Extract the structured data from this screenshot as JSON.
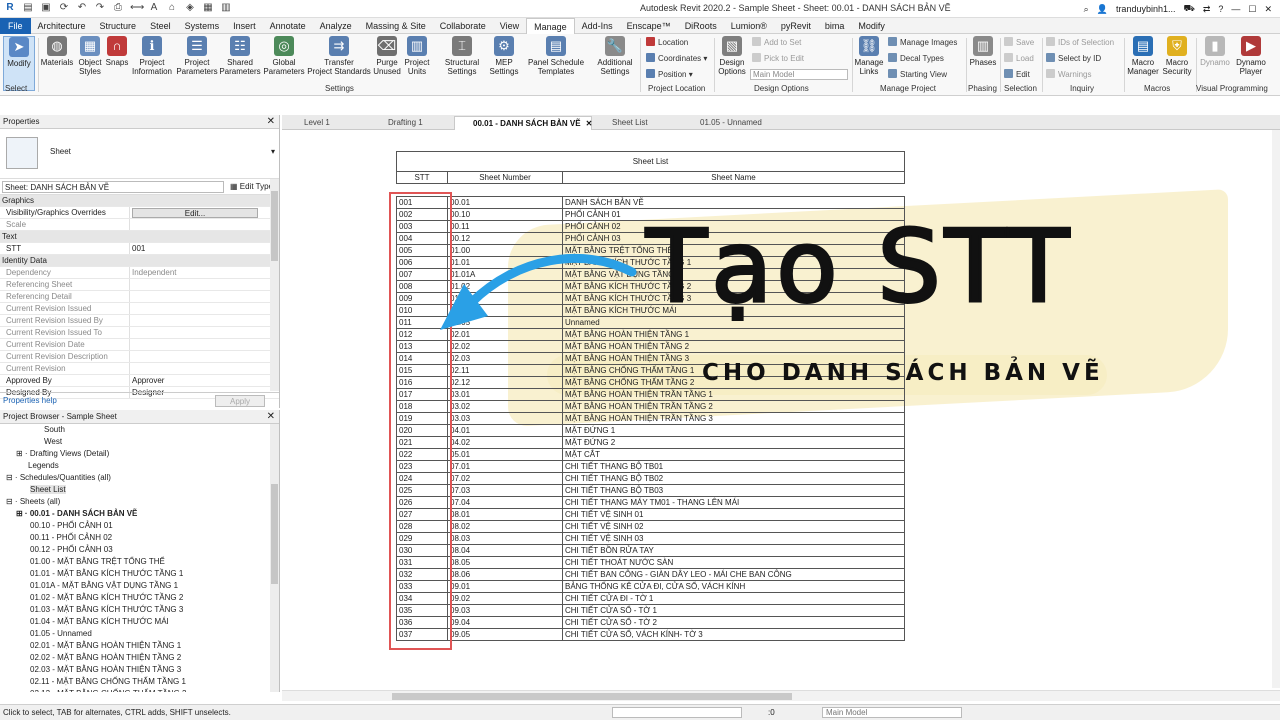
{
  "window": {
    "title": "Autodesk Revit 2020.2 - Sample Sheet - Sheet: 00.01 - DANH SÁCH BẢN VẼ",
    "user": "tranduybinh1..."
  },
  "tabs": [
    "File",
    "Architecture",
    "Structure",
    "Steel",
    "Systems",
    "Insert",
    "Annotate",
    "Analyze",
    "Massing & Site",
    "Collaborate",
    "View",
    "Manage",
    "Add-Ins",
    "Enscape™",
    "DiRoots",
    "Lumion®",
    "pyRevit",
    "bima",
    "Modify"
  ],
  "active_tab": "Manage",
  "ribbon": {
    "modify": "Modify",
    "select_label": "Select",
    "settings_buttons": [
      "Materials",
      "Object\nStyles",
      "Snaps",
      "Project\nInformation",
      "Project\nParameters",
      "Shared\nParameters",
      "Global\nParameters",
      "Transfer\nProject Standards",
      "Purge\nUnused",
      "Project\nUnits",
      "Structural\nSettings",
      "MEP\nSettings",
      "Panel Schedule\nTemplates",
      "Additional\nSettings"
    ],
    "settings_label": "Settings",
    "location_items": [
      "Location",
      "Coordinates",
      "Position"
    ],
    "location_label": "Project Location",
    "design_options": "Design\nOptions",
    "add_to_set": "Add to Set",
    "pick_to_edit": "Pick to Edit",
    "main_model": "Main Model",
    "design_options_label": "Design Options",
    "manage_links": "Manage\nLinks",
    "manage_images": "Manage Images",
    "decal_types": "Decal Types",
    "starting_view": "Starting View",
    "manage_project_label": "Manage Project",
    "phases": "Phases",
    "phasing_label": "Phasing",
    "save": "Save",
    "load": "Load",
    "edit": "Edit",
    "selection_label": "Selection",
    "ids_of_selection": "IDs of Selection",
    "select_by_id": "Select by ID",
    "warnings": "Warnings",
    "inquiry_label": "Inquiry",
    "macro_manager": "Macro\nManager",
    "macro_security": "Macro\nSecurity",
    "macros_label": "Macros",
    "dynamo": "Dynamo",
    "dynamo_player": "Dynamo\nPlayer",
    "visual_programming_label": "Visual Programming"
  },
  "properties": {
    "title": "Properties",
    "type_name": "Sheet",
    "instance": "Sheet: DANH SÁCH BẢN VẼ",
    "edit_type": "Edit Type",
    "rows": [
      {
        "k": "Graphics",
        "v": "",
        "group": true
      },
      {
        "k": "Visibility/Graphics Overrides",
        "v": "Edit...",
        "button": true
      },
      {
        "k": "Scale",
        "v": "",
        "gray": true
      },
      {
        "k": "Text",
        "v": "",
        "group": true
      },
      {
        "k": "STT",
        "v": "001"
      },
      {
        "k": "Identity Data",
        "v": "",
        "group": true
      },
      {
        "k": "Dependency",
        "v": "Independent",
        "gray": true
      },
      {
        "k": "Referencing Sheet",
        "v": "",
        "gray": true
      },
      {
        "k": "Referencing Detail",
        "v": "",
        "gray": true
      },
      {
        "k": "Current Revision Issued",
        "v": "",
        "gray": true
      },
      {
        "k": "Current Revision Issued By",
        "v": "",
        "gray": true
      },
      {
        "k": "Current Revision Issued To",
        "v": "",
        "gray": true
      },
      {
        "k": "Current Revision Date",
        "v": "",
        "gray": true
      },
      {
        "k": "Current Revision Description",
        "v": "",
        "gray": true
      },
      {
        "k": "Current Revision",
        "v": "",
        "gray": true
      },
      {
        "k": "Approved By",
        "v": "Approver"
      },
      {
        "k": "Designed By",
        "v": "Designer"
      }
    ],
    "help": "Properties help",
    "apply": "Apply"
  },
  "browser": {
    "title": "Project Browser - Sample Sheet",
    "items": [
      {
        "t": "South",
        "i": 44
      },
      {
        "t": "West",
        "i": 44
      },
      {
        "t": "⊞ · Drafting Views (Detail)",
        "i": 16
      },
      {
        "t": "Legends",
        "i": 28
      },
      {
        "t": "⊟ · Schedules/Quantities (all)",
        "i": 6
      },
      {
        "t": "Sheet List",
        "i": 30,
        "hl": true
      },
      {
        "t": "⊟ · Sheets (all)",
        "i": 6
      },
      {
        "t": "⊞ · 00.01 - DANH SÁCH BẢN VẼ",
        "i": 16,
        "bold": true
      },
      {
        "t": "00.10 - PHỐI CẢNH 01",
        "i": 30
      },
      {
        "t": "00.11 - PHỐI CẢNH 02",
        "i": 30
      },
      {
        "t": "00.12 - PHỐI CẢNH 03",
        "i": 30
      },
      {
        "t": "01.00 - MẶT BẰNG TRỆT TỔNG THỂ",
        "i": 30
      },
      {
        "t": "01.01 - MẶT BẰNG KÍCH THƯỚC TẦNG 1",
        "i": 30
      },
      {
        "t": "01.01A - MẶT BẰNG VẬT DỤNG TẦNG 1",
        "i": 30
      },
      {
        "t": "01.02 - MẶT BẰNG KÍCH THƯỚC TẦNG 2",
        "i": 30
      },
      {
        "t": "01.03 - MẶT BẰNG KÍCH THƯỚC TẦNG 3",
        "i": 30
      },
      {
        "t": "01.04 - MẶT BẰNG KÍCH THƯỚC MÁI",
        "i": 30
      },
      {
        "t": "01.05 - Unnamed",
        "i": 30
      },
      {
        "t": "02.01 - MẶT BẰNG HOÀN THIỆN TẦNG 1",
        "i": 30
      },
      {
        "t": "02.02 - MẶT BẰNG HOÀN THIỆN TẦNG 2",
        "i": 30
      },
      {
        "t": "02.03 - MẶT BẰNG HOÀN THIỆN TẦNG 3",
        "i": 30
      },
      {
        "t": "02.11 - MẶT BẰNG CHỐNG THẤM TẦNG 1",
        "i": 30
      },
      {
        "t": "02.12 - MẶT BẰNG CHỐNG THẤM TẦNG 2",
        "i": 30
      }
    ]
  },
  "view_tabs": [
    {
      "label": "Level 1",
      "active": false
    },
    {
      "label": "Drafting 1",
      "active": false
    },
    {
      "label": "00.01 - DANH SÁCH BẢN VẼ",
      "active": true
    },
    {
      "label": "Sheet List",
      "active": false
    },
    {
      "label": "01.05 - Unnamed",
      "active": false
    }
  ],
  "schedule": {
    "title": "Sheet List",
    "headers": [
      "STT",
      "Sheet Number",
      "Sheet Name"
    ],
    "rows": [
      [
        "001",
        "00.01",
        "DANH SÁCH BẢN VẼ"
      ],
      [
        "002",
        "00.10",
        "PHỐI CẢNH 01"
      ],
      [
        "003",
        "00.11",
        "PHỐI CẢNH 02"
      ],
      [
        "004",
        "00.12",
        "PHỐI CẢNH 03"
      ],
      [
        "005",
        "01.00",
        "MẶT BẰNG TRỆT TỔNG THỂ"
      ],
      [
        "006",
        "01.01",
        "MẶT BẰNG KÍCH THƯỚC TẦNG 1"
      ],
      [
        "007",
        "01.01A",
        "MẶT BẰNG VẬT DỤNG TẦNG 1"
      ],
      [
        "008",
        "01.02",
        "MẶT BẰNG KÍCH THƯỚC TẦNG 2"
      ],
      [
        "009",
        "01.03",
        "MẶT BẰNG KÍCH THƯỚC TẦNG 3"
      ],
      [
        "010",
        "01.04",
        "MẶT BẰNG KÍCH THƯỚC MÁI"
      ],
      [
        "011",
        "01.05",
        "Unnamed"
      ],
      [
        "012",
        "02.01",
        "MẶT BẰNG HOÀN THIỆN TẦNG 1"
      ],
      [
        "013",
        "02.02",
        "MẶT BẰNG HOÀN THIỆN TẦNG 2"
      ],
      [
        "014",
        "02.03",
        "MẶT BẰNG HOÀN THIỆN TẦNG 3"
      ],
      [
        "015",
        "02.11",
        "MẶT BẰNG CHỐNG THẤM TẦNG 1"
      ],
      [
        "016",
        "02.12",
        "MẶT BẰNG CHỐNG THẤM TẦNG 2"
      ],
      [
        "017",
        "03.01",
        "MẶT BẰNG HOÀN THIỆN TRẦN TẦNG 1"
      ],
      [
        "018",
        "03.02",
        "MẶT BẰNG HOÀN THIỆN TRẦN TẦNG 2"
      ],
      [
        "019",
        "03.03",
        "MẶT BẰNG HOÀN THIỆN TRẦN TẦNG 3"
      ],
      [
        "020",
        "04.01",
        "MẶT ĐỨNG 1"
      ],
      [
        "021",
        "04.02",
        "MẶT ĐỨNG 2"
      ],
      [
        "022",
        "05.01",
        "MẶT CẮT"
      ],
      [
        "023",
        "07.01",
        "CHI TIẾT THANG BỘ TB01"
      ],
      [
        "024",
        "07.02",
        "CHI TIẾT THANG BỘ TB02"
      ],
      [
        "025",
        "07.03",
        "CHI TIẾT THANG BỘ TB03"
      ],
      [
        "026",
        "07.04",
        "CHI TIẾT THANG MÁY TM01 - THANG LÊN MÁI"
      ],
      [
        "027",
        "08.01",
        "CHI TIẾT VỆ SINH 01"
      ],
      [
        "028",
        "08.02",
        "CHI TIẾT VỆ SINH 02"
      ],
      [
        "029",
        "08.03",
        "CHI TIẾT VỆ SINH 03"
      ],
      [
        "030",
        "08.04",
        "CHI TIẾT BỒN RỬA TAY"
      ],
      [
        "031",
        "08.05",
        "CHI TIẾT THOÁT NƯỚC SÀN"
      ],
      [
        "032",
        "08.06",
        "CHI TIẾT BAN CÔNG - GIÀN DÂY LEO - MÁI CHE BAN CÔNG"
      ],
      [
        "033",
        "09.01",
        "BẢNG THỐNG KÊ CỬA ĐI, CỬA SỔ, VÁCH KÍNH"
      ],
      [
        "034",
        "09.02",
        "CHI TIẾT CỬA ĐI - TỜ 1"
      ],
      [
        "035",
        "09.03",
        "CHI TIẾT CỬA SỔ - TỜ 1"
      ],
      [
        "036",
        "09.04",
        "CHI TIẾT CỬA SỔ - TỜ 2"
      ],
      [
        "037",
        "09.05",
        "CHI TIẾT CỬA SỔ, VÁCH KÍNH- TỜ 3"
      ]
    ]
  },
  "overlay": {
    "title": "Tạo STT",
    "subtitle": "CHO DANH SÁCH BẢN VẼ",
    "arrow_color": "#2aa0e6",
    "highlight_color": "#e05555"
  },
  "status": {
    "message": "Click to select, TAB for alternates, CTRL adds, SHIFT unselects.",
    "zero": ":0",
    "model": "Main Model"
  }
}
